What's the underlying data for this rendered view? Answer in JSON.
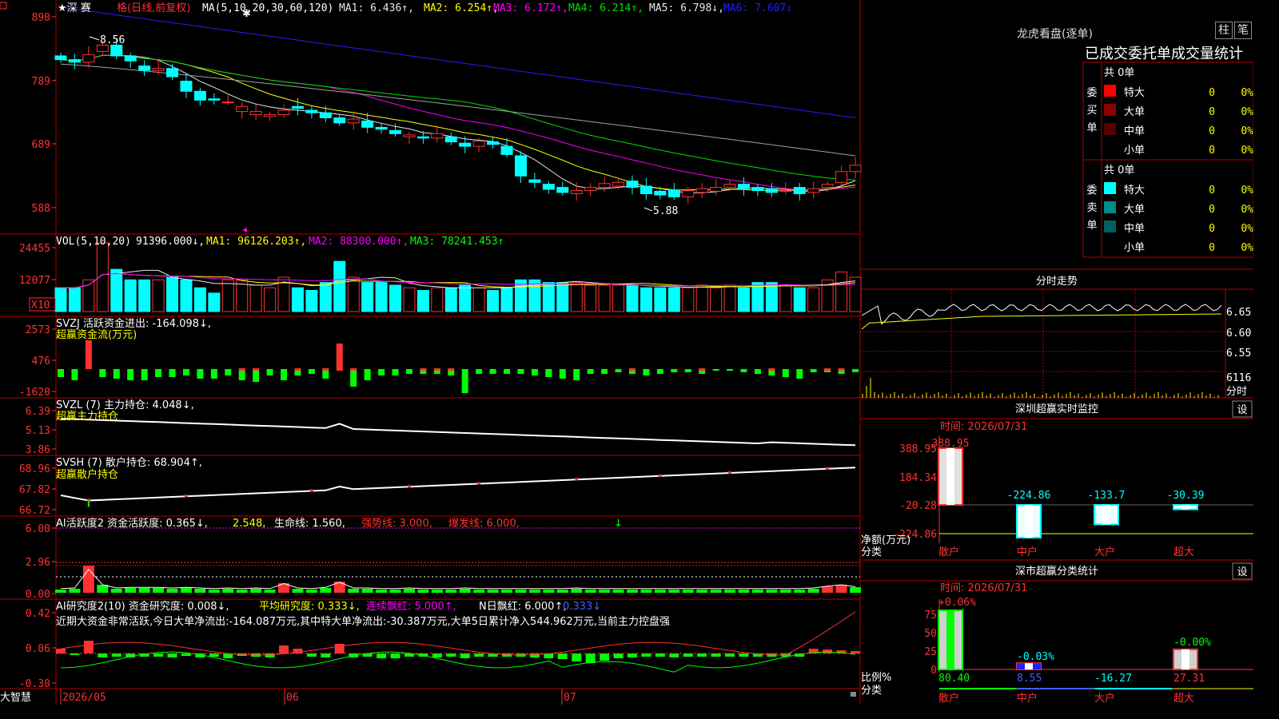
{
  "colors": {
    "up": "#ff3232",
    "down": "#00ffff",
    "grid": "#b40000",
    "axis": "#ff3232",
    "bg": "#000000",
    "ma1": "#e8e8e8",
    "ma2": "#ffff00",
    "ma3": "#ff00ff",
    "ma4": "#00e000",
    "ma5": "#a0a0a0",
    "ma6": "#2020ff",
    "white": "#ffffff",
    "yellow": "#ffff00",
    "magenta": "#ff00ff",
    "green": "#00ff00",
    "cyan": "#00ffff",
    "red": "#ff3232"
  },
  "chart_data": [
    {
      "type": "candlestick",
      "title": "★深 赛 格(日线,前复权)",
      "ma_label": "MA(5,10,20,30,60,120)",
      "ma_values": [
        {
          "name": "MA1",
          "text": "MA1: 6.436↑,"
        },
        {
          "name": "MA2",
          "text": "MA2: 6.254↑,"
        },
        {
          "name": "MA3",
          "text": "MA3: 6.172↑,"
        },
        {
          "name": "MA4",
          "text": "MA4: 6.214↑,"
        },
        {
          "name": "MA5",
          "text": "MA5: 6.798↓,"
        },
        {
          "name": "MA6",
          "text": "MA6: 7.607↓"
        }
      ],
      "y_ticks": [
        "890",
        "789",
        "689",
        "588"
      ],
      "y_tick_values": [
        8.9,
        7.89,
        6.89,
        5.88
      ],
      "ylim": [
        5.5,
        9.1
      ],
      "annotations": [
        {
          "text": "8.56",
          "value": 8.56
        },
        {
          "text": "5.88",
          "value": 5.88
        }
      ],
      "x_labels": [
        "2026/05",
        "06",
        "07"
      ]
    },
    {
      "type": "bar",
      "title": "VOL(5,10,20)",
      "values_text": [
        {
          "name": "vol",
          "text": "91396.000↓,"
        },
        {
          "name": "MA1",
          "text": "MA1: 96126.203↑,"
        },
        {
          "name": "MA2",
          "text": "MA2: 88300.000↑,"
        },
        {
          "name": "MA3",
          "text": "MA3: 78241.453↑"
        }
      ],
      "y_ticks": [
        "24455",
        "12077"
      ],
      "y_tick_values": [
        24455,
        12077
      ],
      "unit": "X10"
    },
    {
      "type": "bar",
      "title": "SVZJ  活跃资金进出: -164.098↓,",
      "subtitle": "超赢资金流(万元)",
      "y_ticks": [
        "2573",
        "476",
        "-1620"
      ]
    },
    {
      "type": "line",
      "title": "SVZL (7) 主力持仓: 4.048↓,",
      "subtitle": "超赢主力持仓",
      "y_ticks": [
        "6.39",
        "5.13",
        "3.86"
      ]
    },
    {
      "type": "line",
      "title": "SVSH (7) 散户持仓: 68.904↑,",
      "subtitle": "超赢散户持仓",
      "y_ticks": [
        "68.96",
        "67.82",
        "66.72"
      ]
    },
    {
      "type": "bar",
      "title_parts": [
        {
          "name": "title",
          "text": "AI活跃度2 资金活跃度: 0.365↓,"
        },
        {
          "name": "v2",
          "text": "2.548,"
        },
        {
          "name": "life",
          "text": "生命线: 1.560,"
        },
        {
          "name": "strong",
          "text": "强势线: 3.000,"
        },
        {
          "name": "burst",
          "text": "爆发线: 6.000,"
        }
      ],
      "y_ticks": [
        "6.00",
        "2.96",
        "0.00"
      ]
    },
    {
      "type": "bar",
      "title_parts": [
        {
          "name": "title",
          "text": "AI研究度2(10) 资金研究度: 0.008↓,"
        },
        {
          "name": "avg",
          "text": "平均研究度: 0.333↓,"
        },
        {
          "name": "red",
          "text": "连续飘红: 5.000↑,"
        },
        {
          "name": "nday",
          "text": "N日飘红: 6.000↑,"
        },
        {
          "name": "last",
          "text": "0.333↓"
        }
      ],
      "comment": "近期大资金非常活跃,今日大单净流出:-164.087万元,其中特大单净流出:-30.387万元,大单5日累计净入544.962万元,当前主力控盘强",
      "y_ticks": [
        "0.42",
        "0.06",
        "-0.30"
      ]
    }
  ],
  "left_bottom_label": "大智慧",
  "right_panel": {
    "lhkp_title": "龙虎看盘(逐单)",
    "btn_zhu": "柱",
    "btn_bi": "笔",
    "header": "已成交委托单成交量统计",
    "buy": {
      "side_label": "委买单",
      "total": "共 0单",
      "rows": [
        {
          "label": "特大",
          "count": "0",
          "pct": "0%",
          "color": "#ff0000"
        },
        {
          "label": "大单",
          "count": "0",
          "pct": "0%",
          "color": "#8b0000"
        },
        {
          "label": "中单",
          "count": "0",
          "pct": "0%",
          "color": "#5a0000"
        },
        {
          "label": "小单",
          "count": "0",
          "pct": "0%",
          "color": ""
        }
      ]
    },
    "sell": {
      "side_label": "委卖单",
      "total": "共 0单",
      "rows": [
        {
          "label": "特大",
          "count": "0",
          "pct": "0%",
          "color": "#00ffff"
        },
        {
          "label": "大单",
          "count": "0",
          "pct": "0%",
          "color": "#008b8b"
        },
        {
          "label": "中单",
          "count": "0",
          "pct": "0%",
          "color": "#006060"
        },
        {
          "label": "小单",
          "count": "0",
          "pct": "0%",
          "color": ""
        }
      ]
    },
    "fs": {
      "title": "分时走势",
      "ticks": [
        "6.65",
        "6.60",
        "6.55"
      ],
      "vol": "6116",
      "bottom": "分时"
    },
    "monitor": {
      "title": "深圳超赢实时监控",
      "btn": "设",
      "time": "时间: 2026/07/31",
      "ylabel_1": "净额(万元)",
      "ylabel_2": "分类",
      "y_ticks": [
        "388.95",
        "184.34",
        "-20.28",
        "-224.86"
      ],
      "categories": [
        "散户",
        "中户",
        "大户",
        "超大"
      ],
      "values": [
        388.95,
        -224.86,
        -133.7,
        -30.39
      ],
      "value_labels": [
        "388.95",
        "-224.86",
        "-133.7",
        "-30.39"
      ]
    },
    "classify": {
      "title": "深市超赢分类统计",
      "btn": "设",
      "time": "时间: 2026/07/31",
      "ylabel_1": "比例%",
      "ylabel_2": "分类",
      "y_ticks": [
        "75",
        "50",
        "25",
        "0"
      ],
      "categories": [
        "散户",
        "中户",
        "大户",
        "超大"
      ],
      "top_labels": [
        "+0.06%",
        "-0.03%",
        "",
        "-0.00%"
      ],
      "values": [
        80.4,
        8.55,
        -16.27,
        27.31
      ],
      "value_labels": [
        "80.40",
        "8.55",
        "-16.27",
        "27.31"
      ]
    }
  }
}
